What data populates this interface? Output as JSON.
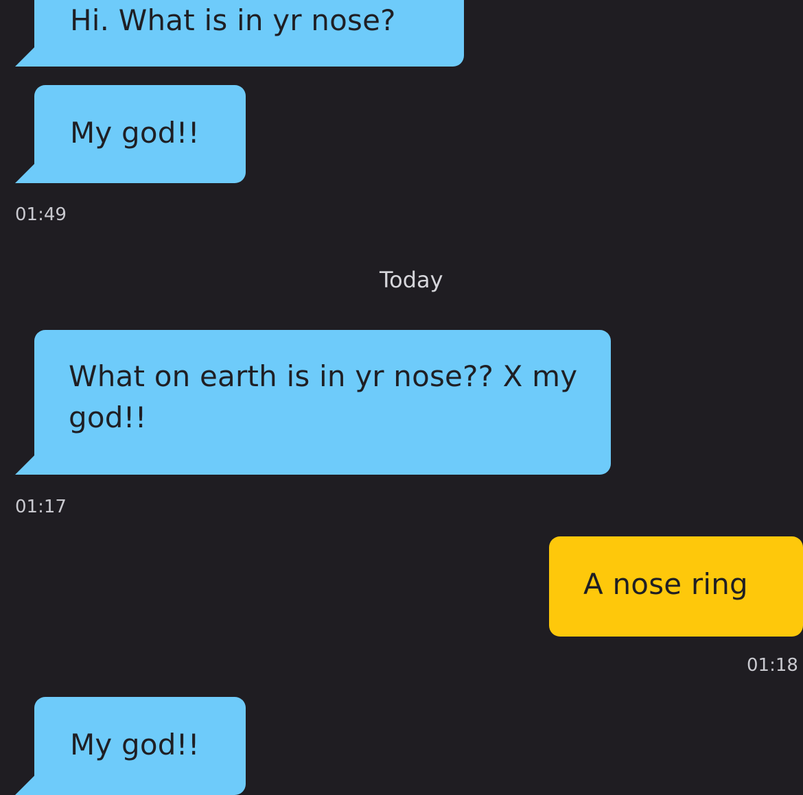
{
  "messages": [
    {
      "direction": "incoming",
      "text": "Hi. What is in yr nose?"
    },
    {
      "direction": "incoming",
      "text": "My god!!"
    },
    {
      "direction": "incoming",
      "text": "What on earth is in yr nose?? X my god!!"
    },
    {
      "direction": "outgoing",
      "text": "A nose ring"
    },
    {
      "direction": "incoming",
      "text": "My god!!"
    }
  ],
  "timestamps": {
    "first_group": "01:49",
    "second_message": "01:17",
    "reply": "01:18"
  },
  "day_divider": "Today",
  "colors": {
    "background": "#1f1d22",
    "incoming_bubble": "#6ecbfa",
    "outgoing_bubble": "#fec80b",
    "timestamp_text": "#c9c9cf"
  }
}
